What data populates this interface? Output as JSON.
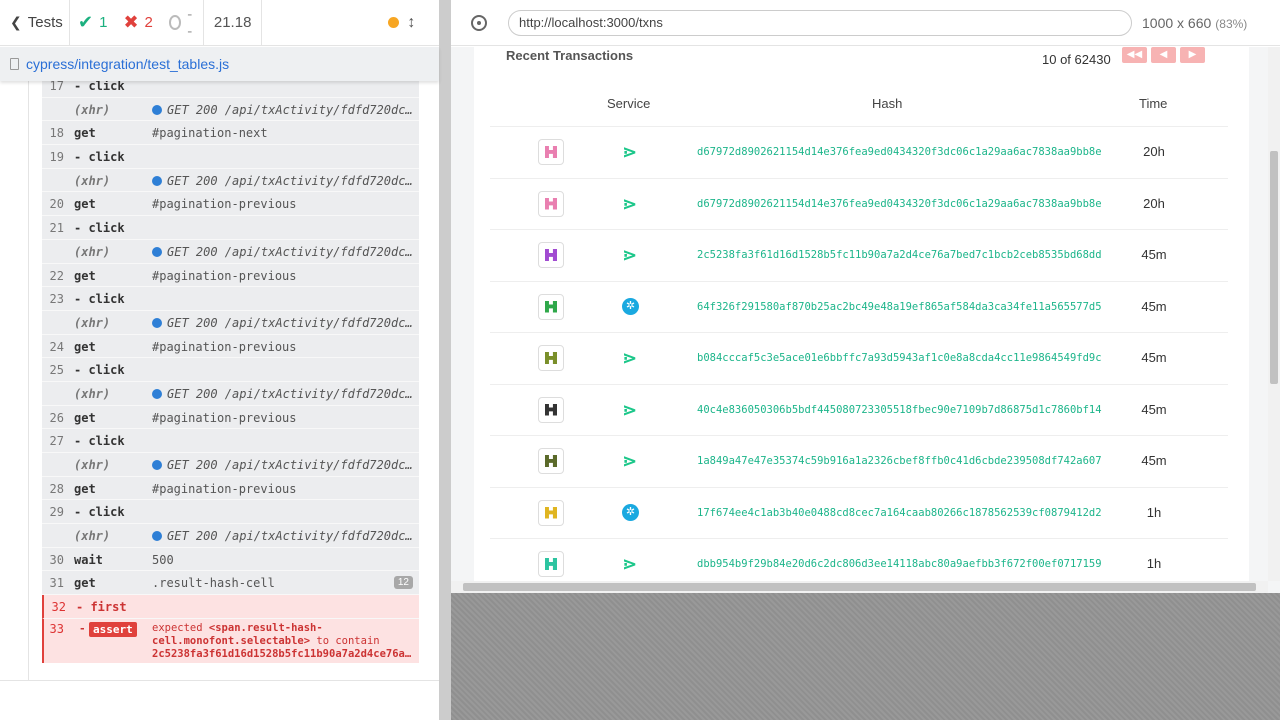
{
  "reporter": {
    "header": {
      "tests_label": "Tests",
      "passed": "1",
      "failed": "2",
      "pending": "--",
      "duration": "21.18"
    },
    "spec_file": "cypress/integration/test_tables.js",
    "commands": [
      {
        "num": "17",
        "name": "- click",
        "msg": "",
        "type": "child"
      },
      {
        "num": "",
        "name": "(xhr)",
        "msg": "GET 200 /api/txActivity/fdfd720dc…",
        "type": "xhr"
      },
      {
        "num": "18",
        "name": "get",
        "msg": "#pagination-next",
        "type": "cmd"
      },
      {
        "num": "19",
        "name": "- click",
        "msg": "",
        "type": "child"
      },
      {
        "num": "",
        "name": "(xhr)",
        "msg": "GET 200 /api/txActivity/fdfd720dc…",
        "type": "xhr"
      },
      {
        "num": "20",
        "name": "get",
        "msg": "#pagination-previous",
        "type": "cmd"
      },
      {
        "num": "21",
        "name": "- click",
        "msg": "",
        "type": "child"
      },
      {
        "num": "",
        "name": "(xhr)",
        "msg": "GET 200 /api/txActivity/fdfd720dc…",
        "type": "xhr"
      },
      {
        "num": "22",
        "name": "get",
        "msg": "#pagination-previous",
        "type": "cmd"
      },
      {
        "num": "23",
        "name": "- click",
        "msg": "",
        "type": "child"
      },
      {
        "num": "",
        "name": "(xhr)",
        "msg": "GET 200 /api/txActivity/fdfd720dc…",
        "type": "xhr"
      },
      {
        "num": "24",
        "name": "get",
        "msg": "#pagination-previous",
        "type": "cmd"
      },
      {
        "num": "25",
        "name": "- click",
        "msg": "",
        "type": "child"
      },
      {
        "num": "",
        "name": "(xhr)",
        "msg": "GET 200 /api/txActivity/fdfd720dc…",
        "type": "xhr"
      },
      {
        "num": "26",
        "name": "get",
        "msg": "#pagination-previous",
        "type": "cmd"
      },
      {
        "num": "27",
        "name": "- click",
        "msg": "",
        "type": "child"
      },
      {
        "num": "",
        "name": "(xhr)",
        "msg": "GET 200 /api/txActivity/fdfd720dc…",
        "type": "xhr"
      },
      {
        "num": "28",
        "name": "get",
        "msg": "#pagination-previous",
        "type": "cmd"
      },
      {
        "num": "29",
        "name": "- click",
        "msg": "",
        "type": "child"
      },
      {
        "num": "",
        "name": "(xhr)",
        "msg": "GET 200 /api/txActivity/fdfd720dc…",
        "type": "xhr"
      },
      {
        "num": "30",
        "name": "wait",
        "msg": "500",
        "type": "cmd"
      },
      {
        "num": "31",
        "name": "get",
        "msg": ".result-hash-cell",
        "type": "cmd",
        "badge": "12"
      },
      {
        "num": "32",
        "name": "- first",
        "msg": "",
        "type": "err"
      }
    ],
    "assert": {
      "num": "33",
      "dash": "-",
      "label": "assert",
      "expected": "expected",
      "selector": "<span.result-hash-cell.monofont.selectable>",
      "to_contain": "to contain",
      "hash": "2c5238fa3f61d16d1528b5fc11b90a7a2d4ce76a7…"
    }
  },
  "aut": {
    "url": "http://localhost:3000/txns",
    "viewport": "1000 x 660",
    "scale": "(83%)",
    "title": "Recent Transactions",
    "page_count": "10 of 62430",
    "pagination": {
      "first": "◀◀",
      "prev": "◀",
      "next": "▶"
    },
    "columns": {
      "service": "Service",
      "hash": "Hash",
      "time": "Time"
    },
    "rows": [
      {
        "hash": "d67972d8902621154d14e376fea9ed0434320f3dc06c1a29aa6ac7838aa9bb8e",
        "time": "20h",
        "avatar_color": "#e97fb0",
        "service": "arrow"
      },
      {
        "hash": "d67972d8902621154d14e376fea9ed0434320f3dc06c1a29aa6ac7838aa9bb8e",
        "time": "20h",
        "avatar_color": "#e97fb0",
        "service": "arrow"
      },
      {
        "hash": "2c5238fa3f61d16d1528b5fc11b90a7a2d4ce76a7bed7c1bcb2ceb8535bd68dd",
        "time": "45m",
        "avatar_color": "#a14bd1",
        "service": "arrow"
      },
      {
        "hash": "64f326f291580af870b25ac2bc49e48a19ef865af584da3ca34fe11a565577d5",
        "time": "45m",
        "avatar_color": "#2fa84a",
        "service": "circle"
      },
      {
        "hash": "b084cccaf5c3e5ace01e6bbffc7a93d5943af1c0e8a8cda4cc11e9864549fd9c",
        "time": "45m",
        "avatar_color": "#7a8f2a",
        "service": "arrow"
      },
      {
        "hash": "40c4e836050306b5bdf445080723305518fbec90e7109b7d86875d1c7860bf14",
        "time": "45m",
        "avatar_color": "#333333",
        "service": "arrow"
      },
      {
        "hash": "1a849a47e47e35374c59b916a1a2326cbef8ffb0c41d6cbde239508df742a607",
        "time": "45m",
        "avatar_color": "#5b6a2a",
        "service": "arrow"
      },
      {
        "hash": "17f674ee4c1ab3b40e0488cd8cec7a164caab80266c1878562539cf0879412d2",
        "time": "1h",
        "avatar_color": "#e0b520",
        "service": "circle"
      },
      {
        "hash": "dbb954b9f29b84e20d6c2dc806d3ee14118abc80a9aefbb3f672f00ef0717159",
        "time": "1h",
        "avatar_color": "#2cc4a0",
        "service": "arrow"
      }
    ]
  },
  "colors": {
    "pass": "#1bb07f",
    "fail": "#e0413c",
    "hash": "#1cb58a",
    "xhr_dot": "#2e7fd6"
  },
  "icons": {
    "back": "chevron-left-icon",
    "check": "check-icon",
    "x": "x-icon",
    "pending": "circle-icon",
    "running": "orange-dot-icon",
    "scroll": "up-down-arrows-icon",
    "stop": "stop-icon",
    "file": "file-icon",
    "target": "crosshair-icon"
  }
}
